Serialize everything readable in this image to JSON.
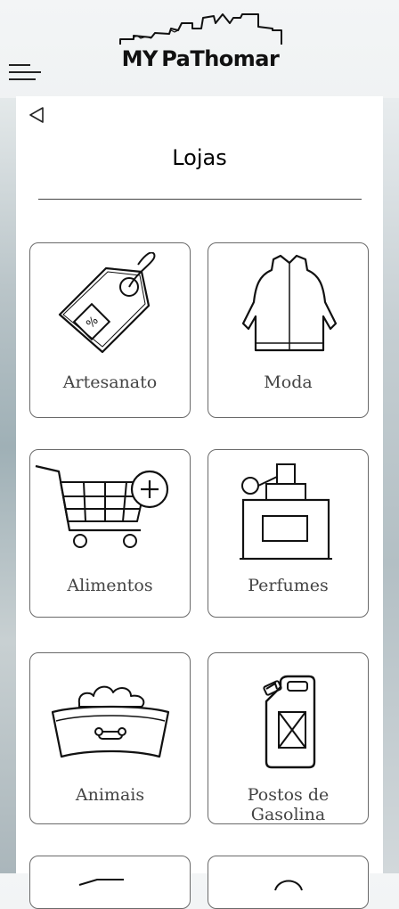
{
  "header": {
    "logo_text": "MY PaThomar",
    "menu_icon": "hamburger-menu-icon"
  },
  "page": {
    "title": "Lojas",
    "back_icon": "back-triangle-icon"
  },
  "categories": [
    {
      "label": "Artesanato",
      "icon": "price-tag-icon"
    },
    {
      "label": "Moda",
      "icon": "jacket-icon"
    },
    {
      "label": "Alimentos",
      "icon": "shopping-cart-plus-icon"
    },
    {
      "label": "Perfumes",
      "icon": "perfume-bottle-icon"
    },
    {
      "label": "Animais",
      "icon": "pet-food-bowl-icon"
    },
    {
      "label": "Postos de Gasolina",
      "icon": "jerry-can-icon"
    }
  ]
}
